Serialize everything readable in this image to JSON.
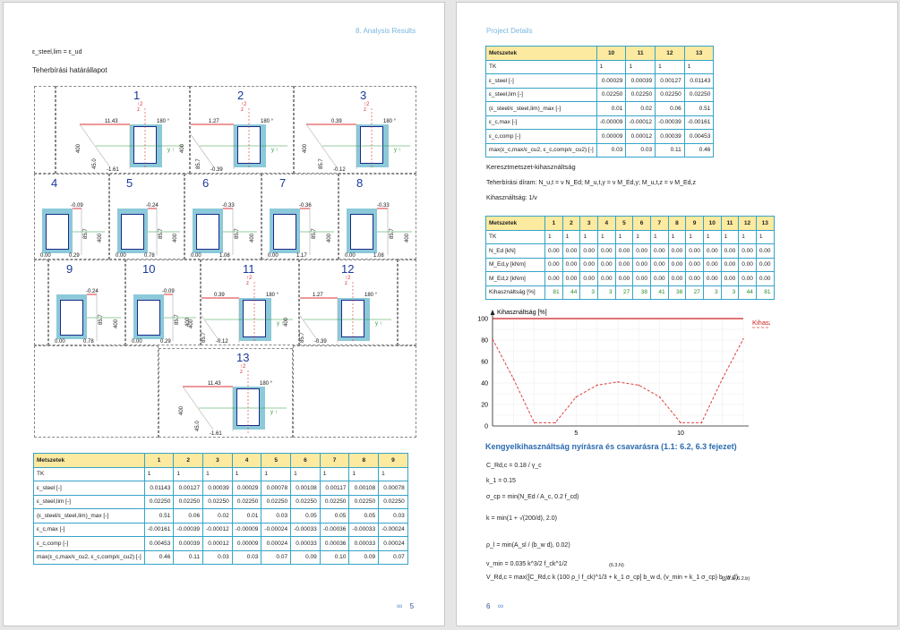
{
  "left_page": {
    "header": "8. Analysis Results",
    "eq_line": "ε_steel,lim = ε_ud",
    "section_title": "Teherbírási határállapot",
    "page_number": "5",
    "diagrams": [
      {
        "num": "1",
        "top": "11.43",
        "angle": "180 °",
        "side": "400",
        "side2": "45.0",
        "bottom": "-1.61"
      },
      {
        "num": "2",
        "top": "1.27",
        "angle": "180 °",
        "side": "400",
        "side2": "85.7",
        "bottom": "-0.39"
      },
      {
        "num": "3",
        "top": "0.39",
        "angle": "180 °",
        "side": "400",
        "side2": "85.7",
        "bottom": "-0.12"
      },
      {
        "num": "4",
        "top": "-0.09",
        "side": "400",
        "side2": "85.7",
        "b1": "0.00",
        "b2": "0.29"
      },
      {
        "num": "5",
        "top": "-0.24",
        "side": "400",
        "side2": "85.7",
        "b1": "0.00",
        "b2": "0.78"
      },
      {
        "num": "6",
        "top": "-0.33",
        "side": "400",
        "side2": "85.7",
        "b1": "0.00",
        "b2": "1.08"
      },
      {
        "num": "7",
        "top": "-0.36",
        "side": "400",
        "side2": "85.7",
        "b1": "0.00",
        "b2": "1.17"
      },
      {
        "num": "8",
        "top": "-0.33",
        "side": "400",
        "side2": "85.7",
        "b1": "0.00",
        "b2": "1.08"
      },
      {
        "num": "9",
        "top": "-0.24",
        "side": "400",
        "side2": "85.7",
        "b1": "0.00",
        "b2": "0.78"
      },
      {
        "num": "10",
        "top": "-0.09",
        "side": "400",
        "side2": "85.7",
        "b1": "0.00",
        "b2": "0.29"
      },
      {
        "num": "11",
        "top": "0.39",
        "angle": "180 °",
        "side": "400",
        "side2": "85.7",
        "bottom": "-0.12"
      },
      {
        "num": "12",
        "top": "1.27",
        "angle": "180 °",
        "side": "400",
        "side2": "85.7",
        "bottom": "-0.39"
      },
      {
        "num": "13",
        "top": "11.43",
        "angle": "180 °",
        "side": "400",
        "side2": "45.0",
        "bottom": "-1.61"
      }
    ],
    "axis": {
      "z": "z",
      "y": "y"
    },
    "table": {
      "header": [
        "Metszetek",
        "1",
        "2",
        "3",
        "4",
        "5",
        "6",
        "7",
        "8",
        "9"
      ],
      "rows": [
        [
          "TK",
          "1",
          "1",
          "1",
          "1",
          "1",
          "1",
          "1",
          "1",
          "1"
        ],
        [
          "ε_steel [-]",
          "0.01143",
          "0.00127",
          "0.00039",
          "0.00029",
          "0.00078",
          "0.00108",
          "0.00117",
          "0.00108",
          "0.00078"
        ],
        [
          "ε_steel,lim [-]",
          "0.02250",
          "0.02250",
          "0.02250",
          "0.02250",
          "0.02250",
          "0.02250",
          "0.02250",
          "0.02250",
          "0.02250"
        ],
        [
          "(ε_steel/ε_steel,lim)_max [-]",
          "0.51",
          "0.06",
          "0.02",
          "0.01",
          "0.03",
          "0.05",
          "0.05",
          "0.05",
          "0.03"
        ],
        [
          "ε_c,max [-]",
          "-0.00161",
          "-0.00039",
          "-0.00012",
          "-0.00009",
          "-0.00024",
          "-0.00033",
          "-0.00036",
          "-0.00033",
          "-0.00024"
        ],
        [
          "ε_c,comp [-]",
          "0.00453",
          "0.00039",
          "0.00012",
          "0.00009",
          "0.00024",
          "0.00033",
          "0.00036",
          "0.00033",
          "0.00024"
        ],
        [
          "max(ε_c,max/ε_cu2, ε_c,comp/ε_cu2) [-]",
          "0.46",
          "0.11",
          "0.03",
          "0.03",
          "0.07",
          "0.09",
          "0.10",
          "0.09",
          "0.07"
        ]
      ]
    }
  },
  "right_page": {
    "header": "Project Details",
    "page_number": "6",
    "table1": {
      "header": [
        "Metszetek",
        "10",
        "11",
        "12",
        "13"
      ],
      "rows": [
        [
          "TK",
          "1",
          "1",
          "1",
          "1"
        ],
        [
          "ε_steel [-]",
          "0.00029",
          "0.00039",
          "0.00127",
          "0.01143"
        ],
        [
          "ε_steel,lim [-]",
          "0.02250",
          "0.02250",
          "0.02250",
          "0.02250"
        ],
        [
          "(ε_steel/ε_steel,lim)_max [-]",
          "0.01",
          "0.02",
          "0.06",
          "0.51"
        ],
        [
          "ε_c,max [-]",
          "-0.00009",
          "-0.00012",
          "-0.00039",
          "-0.00161"
        ],
        [
          "ε_c,comp [-]",
          "0.00009",
          "0.00012",
          "0.00039",
          "0.00453"
        ],
        [
          "max(ε_c,max/ε_cu2, ε_c,comp/ε_cu2) [-]",
          "0.03",
          "0.03",
          "0.11",
          "0.46"
        ]
      ]
    },
    "util_title": "Keresztmetszet-kihasználtság",
    "util_eq1": "Teherbírási díram: N_u,t = ν N_Ed; M_u,t,y = ν M_Ed,y; M_u,t,z = ν M_Ed,z",
    "util_eq2": "Kihasználtság: 1/ν",
    "table2": {
      "header": [
        "Metszetek",
        "1",
        "2",
        "3",
        "4",
        "5",
        "6",
        "7",
        "8",
        "9",
        "10",
        "11",
        "12",
        "13"
      ],
      "rows": [
        [
          "TK",
          "1",
          "1",
          "1",
          "1",
          "1",
          "1",
          "1",
          "1",
          "1",
          "1",
          "1",
          "1",
          "1"
        ],
        [
          "N_Ed [kN]",
          "0.00",
          "0.00",
          "0.00",
          "0.00",
          "0.00",
          "0.00",
          "0.00",
          "0.00",
          "0.00",
          "0.00",
          "0.00",
          "0.00",
          "0.00"
        ],
        [
          "M_Ed,y [kNm]",
          "0.00",
          "0.00",
          "0.00",
          "0.00",
          "0.00",
          "0.00",
          "0.00",
          "0.00",
          "0.00",
          "0.00",
          "0.00",
          "0.00",
          "0.00"
        ],
        [
          "M_Ed,z [kNm]",
          "0.00",
          "0.00",
          "0.00",
          "0.00",
          "0.00",
          "0.00",
          "0.00",
          "0.00",
          "0.00",
          "0.00",
          "0.00",
          "0.00",
          "0.00"
        ],
        [
          "Kihasználtság [%]",
          "81",
          "44",
          "3",
          "3",
          "27",
          "38",
          "41",
          "38",
          "27",
          "3",
          "3",
          "44",
          "81"
        ]
      ]
    },
    "stirrup_title": "Kengyelkihasználtság nyírásra és csavarásra (1.1: 6.2, 6.3 fejezet)",
    "eqs": [
      "C_Rd,c = 0.18 / γ_c",
      "k_1 = 0.15",
      "σ_cp = min(N_Ed / A_c, 0.2 f_cd)",
      "k = min(1 + √(200/d), 2.0)",
      "ρ_l = min(A_sl / (b_w d), 0.02)",
      "v_min = 0.035 k^3/2 f_ck^1/2",
      "V_Rd,c = max([C_Rd,c k (100 ρ_l f_ck)^1/3 + k_1 σ_cp] b_w d, (v_min + k_1 σ_cp) b_w d)"
    ],
    "eq_refs": [
      "(6.3.N)",
      "(6.2.a, 6.2.b)"
    ]
  },
  "chart_data": {
    "type": "line",
    "title": "Kihasználtság [%]",
    "ylim": [
      0,
      100
    ],
    "yticks": [
      0,
      20,
      40,
      60,
      80,
      100
    ],
    "xticks": [
      5,
      10
    ],
    "series": [
      {
        "name": "Kihasználtság",
        "x": [
          1,
          2,
          3,
          4,
          5,
          6,
          7,
          8,
          9,
          10,
          11,
          12,
          13
        ],
        "values": [
          81,
          44,
          3,
          3,
          27,
          38,
          41,
          38,
          27,
          3,
          3,
          44,
          81
        ],
        "color": "#e04040"
      }
    ],
    "limit_line": {
      "value": 100,
      "color": "#cc2222"
    },
    "legend": "Kihasználtság"
  }
}
